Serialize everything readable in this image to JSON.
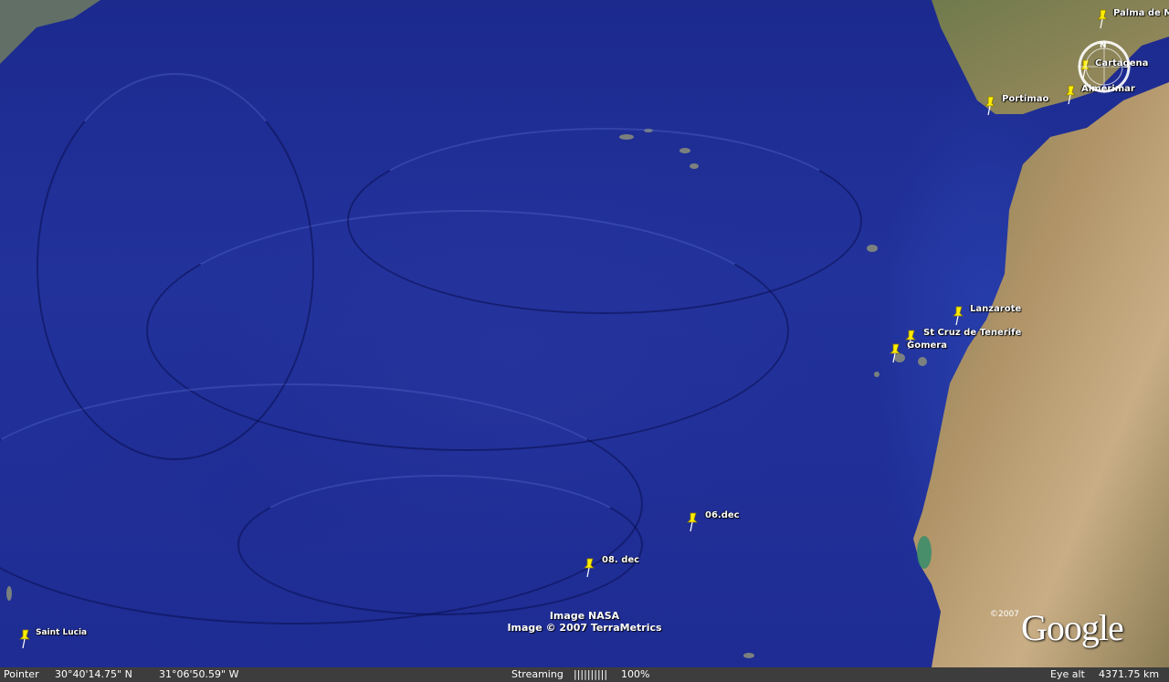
{
  "map": {
    "placemarks": [
      {
        "id": "palma",
        "label": "Palma de Ma"
      },
      {
        "id": "cartagena",
        "label": "Cartagena"
      },
      {
        "id": "almerimar",
        "label": "Almerimar"
      },
      {
        "id": "portimao",
        "label": "Portimao"
      },
      {
        "id": "lanzarote",
        "label": "Lanzarote"
      },
      {
        "id": "tenerife",
        "label": "St Cruz de Tenerife"
      },
      {
        "id": "gomera",
        "label": "Gomera"
      },
      {
        "id": "dec06",
        "label": "06.dec"
      },
      {
        "id": "dec08",
        "label": "08. dec"
      },
      {
        "id": "saintlucia",
        "label": "Saint Lucia"
      }
    ],
    "attribution": {
      "line1": "Image NASA",
      "line2": "Image © 2007 TerraMetrics"
    },
    "logo": {
      "text": "Google",
      "copyright": "©2007"
    },
    "compass": {
      "north_label": "N"
    },
    "colors": {
      "ocean": "#1c2a8e",
      "land": "#9c8a5c",
      "pin": "#ffee00"
    }
  },
  "statusbar": {
    "pointer_label": "Pointer",
    "latitude": "30°40'14.75\" N",
    "longitude": "31°06'50.59\" W",
    "streaming_label": "Streaming",
    "streaming_bar": "||||||||||",
    "streaming_pct": "100%",
    "eye_alt_label": "Eye alt",
    "eye_alt_value": "4371.75 km"
  }
}
